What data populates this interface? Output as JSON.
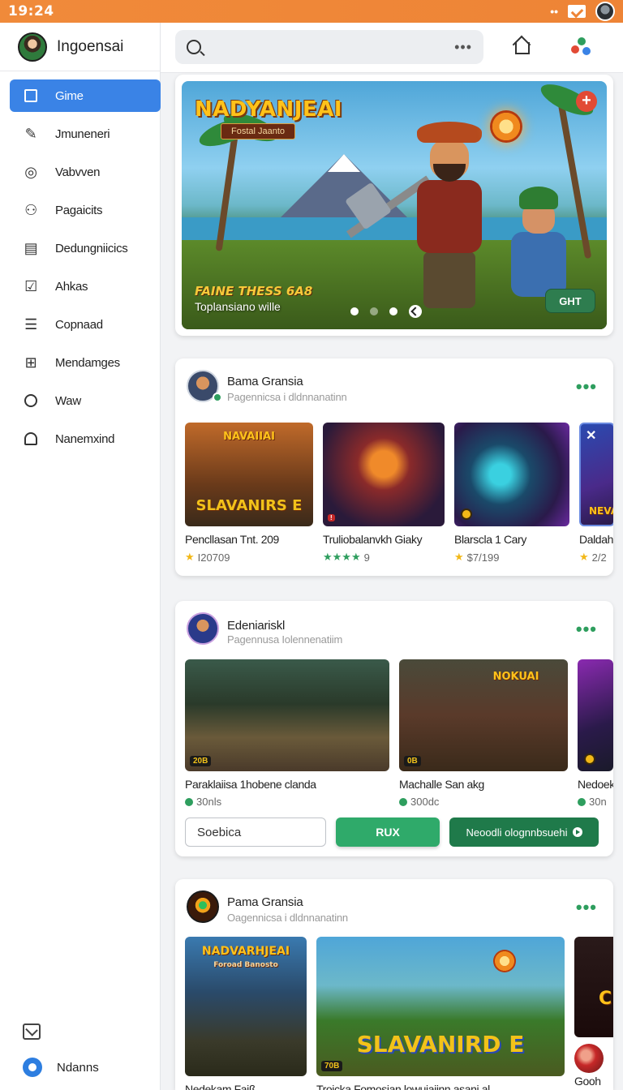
{
  "status_bar": {
    "time": "19:24",
    "dots": "••"
  },
  "brand": {
    "name": "Ingoensai"
  },
  "sidebar": {
    "items": [
      {
        "label": "Gime",
        "icon": "home-square-icon",
        "active": true
      },
      {
        "label": "Jmuneneri",
        "icon": "edit-icon"
      },
      {
        "label": "Vabvven",
        "icon": "target-icon"
      },
      {
        "label": "Pagaicits",
        "icon": "user-icon"
      },
      {
        "label": "Dedungniicics",
        "icon": "document-icon"
      },
      {
        "label": "Ahkas",
        "icon": "checkbox-icon"
      },
      {
        "label": "Copnaad",
        "icon": "list-icon"
      },
      {
        "label": "Mendamges",
        "icon": "book-icon"
      },
      {
        "label": "Waw",
        "icon": "circle-icon"
      },
      {
        "label": "Nanemxind",
        "icon": "house-icon"
      }
    ],
    "bottom_user": "Ndanns"
  },
  "topbar": {
    "search_more": "•••"
  },
  "hero": {
    "title": "NADYANJEAI",
    "subtitle": "Fostal Jaanto",
    "tagline": "FAINE THESS 6A8",
    "subline": "Toplansiano wille",
    "cta": "GHT",
    "plus": "+"
  },
  "sections": [
    {
      "title": "Bama Gransia",
      "subtitle": "Pagennicsa i dldnnanatinn",
      "more": "•••",
      "tiles": [
        {
          "title": "Pencllasan Tnt. 209",
          "meta": "I20709",
          "stars": "★",
          "thumb_text": "NAVAIIAI",
          "thumb_text2": "SLAVANIRS E"
        },
        {
          "title": "Truliobalanvkh Giaky",
          "meta": "9",
          "stars": "★★★★"
        },
        {
          "title": "Blarscla 1 Cary",
          "meta": "$7/199",
          "stars": "★"
        },
        {
          "title": "Daldah",
          "meta": "2/2",
          "stars": "★",
          "thumb_text": "NEVA"
        }
      ]
    },
    {
      "title": "Edeniariskl",
      "subtitle": "Pagennusa Iolennenatiim",
      "more": "•••",
      "tiles": [
        {
          "title": "Paraklaiisa 1hobene clanda",
          "meta": "30nls",
          "badge": "20B"
        },
        {
          "title": "Machalle San akg",
          "meta": "300dc",
          "badge": "0B",
          "thumb_text": "NOKUAI"
        },
        {
          "title": "Nedoek",
          "meta": "30n"
        }
      ],
      "actions": {
        "search": "Soebica",
        "primary": "RUX",
        "secondary": "Neoodli olognnbsuehi"
      }
    },
    {
      "title": "Pama Gransia",
      "subtitle": "Oagennicsa i dldnnanatinn",
      "more": "•••",
      "tiles": [
        {
          "title": "Nedekam Fajß",
          "thumb_text": "NADVARHJEAI",
          "thumb_sub": "Foroad Banosto"
        },
        {
          "title": "Trojcka Fomosian lowuiaiinn asani al",
          "thumb_text": "SLAVANIRD E",
          "badge": "70B"
        },
        {
          "title": "Gooh",
          "thumb_text": "CH"
        }
      ]
    }
  ]
}
